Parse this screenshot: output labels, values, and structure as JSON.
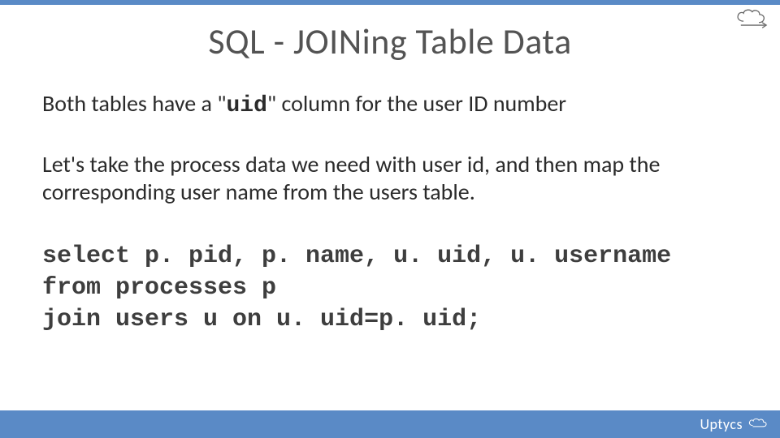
{
  "title": "SQL - JOINing Table Data",
  "body": {
    "p1_a": "Both tables have a \"",
    "p1_uid": "uid",
    "p1_b": "\" column for the user ID number",
    "p2": "Let's take the process data we need with user id, and then map the corresponding user name from the users table."
  },
  "code": {
    "line1": "select p. pid, p. name, u. uid, u. username",
    "line2": "from processes p",
    "line3": "join users u on u. uid=p. uid;"
  },
  "footer": {
    "brand": "Uptycs"
  }
}
